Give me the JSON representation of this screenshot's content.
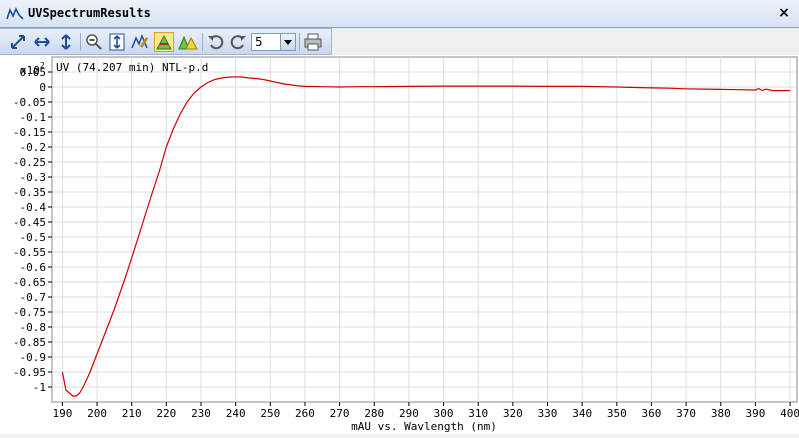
{
  "window": {
    "title": "UVSpectrumResults",
    "close_label": "×"
  },
  "toolbar": {
    "zoom_value": "5",
    "icons": [
      "autoscale-icon",
      "zoom-horizontal-icon",
      "zoom-vertical-icon",
      "zoom-out-icon",
      "fit-vertical-icon",
      "annotate-icon",
      "peak-label-icon",
      "overlay-peaks-icon",
      "undo-icon",
      "redo-icon",
      "print-icon"
    ]
  },
  "colors": {
    "trace": "#d00000",
    "grid": "#dddddd",
    "axis": "#000000"
  },
  "chart_data": {
    "type": "line",
    "title": "UV (74.207 min) NTL-p.d",
    "xlabel": "mAU vs. Wavlength (nm)",
    "ylabel": "",
    "y_multiplier_label": "x10",
    "y_multiplier_exp": "2",
    "xlim": [
      187,
      402
    ],
    "ylim": [
      -1.05,
      0.1
    ],
    "x_ticks": [
      190,
      200,
      210,
      220,
      230,
      240,
      250,
      260,
      270,
      280,
      290,
      300,
      310,
      320,
      330,
      340,
      350,
      360,
      370,
      380,
      390,
      400
    ],
    "y_ticks": [
      0.05,
      0,
      -0.05,
      -0.1,
      -0.15,
      -0.2,
      -0.25,
      -0.3,
      -0.35,
      -0.4,
      -0.45,
      -0.5,
      -0.55,
      -0.6,
      -0.65,
      -0.7,
      -0.75,
      -0.8,
      -0.85,
      -0.9,
      -0.95,
      -1
    ],
    "grid": true,
    "series": [
      {
        "x": [
          190,
          191,
          192,
          193,
          194,
          195,
          196,
          198,
          200,
          202,
          205,
          208,
          210,
          213,
          216,
          218,
          220,
          222,
          224,
          226,
          228,
          230,
          232,
          234,
          236,
          238,
          240,
          242,
          244,
          246,
          248,
          250,
          252,
          254,
          256,
          258,
          260,
          265,
          270,
          275,
          280,
          290,
          300,
          310,
          320,
          330,
          340,
          350,
          360,
          365,
          370,
          375,
          380,
          385,
          390,
          391,
          392,
          393,
          395,
          400
        ],
        "y": [
          -0.95,
          -1.01,
          -1.02,
          -1.03,
          -1.03,
          -1.02,
          -1.0,
          -0.95,
          -0.89,
          -0.83,
          -0.74,
          -0.64,
          -0.57,
          -0.46,
          -0.35,
          -0.28,
          -0.2,
          -0.14,
          -0.09,
          -0.05,
          -0.02,
          0.0,
          0.015,
          0.025,
          0.03,
          0.033,
          0.034,
          0.033,
          0.03,
          0.028,
          0.025,
          0.02,
          0.015,
          0.01,
          0.007,
          0.004,
          0.002,
          0.001,
          0.0,
          0.001,
          0.001,
          0.002,
          0.003,
          0.003,
          0.003,
          0.002,
          0.002,
          0.0,
          -0.003,
          -0.004,
          -0.006,
          -0.007,
          -0.008,
          -0.009,
          -0.01,
          -0.005,
          -0.012,
          -0.007,
          -0.012,
          -0.012
        ]
      }
    ]
  }
}
